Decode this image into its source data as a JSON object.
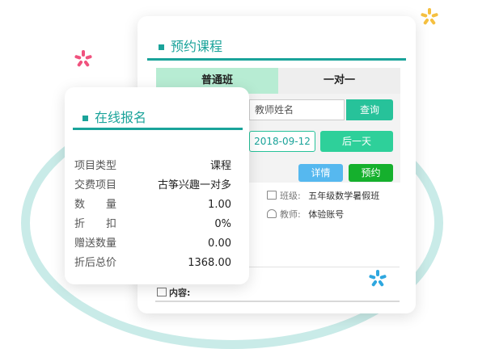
{
  "colors": {
    "accent": "#1aa39a",
    "green_button": "#27c29a",
    "blue_button": "#56b8ef",
    "book_button": "#15b02d",
    "tab_active": "#b7ecd3",
    "ring": "#c9ebe8"
  },
  "booking": {
    "title": "预约课程",
    "tabs": [
      {
        "label": "普通班",
        "active": true
      },
      {
        "label": "一对一",
        "active": false
      }
    ],
    "search": {
      "placeholder": "教师姓名",
      "button": "查询"
    },
    "date": "2018-09-12",
    "next_day": "后一天",
    "detail_button": "详情",
    "book_button": "预约",
    "class_label": "班级:",
    "class_value": "五年级数学暑假班",
    "teacher_label": "教师:",
    "teacher_value": "体验账号",
    "content_label": "内容:"
  },
  "enroll": {
    "title": "在线报名",
    "rows": [
      {
        "label": "项目类型",
        "value": "课程"
      },
      {
        "label": "交费项目",
        "value": "古筝兴趣一对多"
      },
      {
        "label": "数　　量",
        "value": "1.00"
      },
      {
        "label": "折　　扣",
        "value": "0%"
      },
      {
        "label": "赠送数量",
        "value": "0.00"
      },
      {
        "label": "折后总价",
        "value": "1368.00"
      }
    ]
  },
  "icons": [
    "sparkle-icon",
    "class-icon",
    "teacher-icon",
    "book-icon"
  ]
}
